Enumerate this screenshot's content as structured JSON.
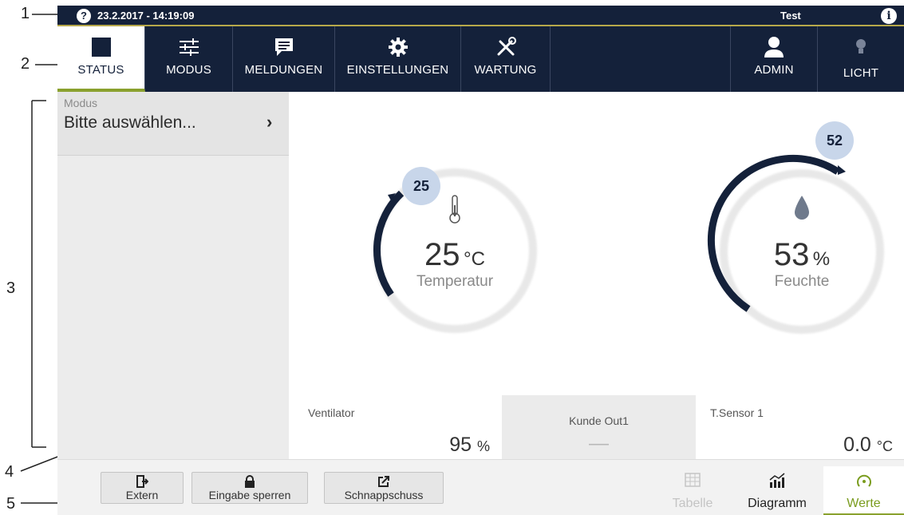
{
  "callouts": [
    "1",
    "2",
    "3",
    "4",
    "5"
  ],
  "statusbar": {
    "help_icon": "?",
    "datetime": "23.2.2017 - 14:19:09",
    "user": "Test",
    "info_icon": "i"
  },
  "nav": {
    "tabs": [
      {
        "label": "STATUS",
        "icon": "stop-square-icon",
        "active": true
      },
      {
        "label": "MODUS",
        "icon": "sliders-icon",
        "active": false
      },
      {
        "label": "MELDUNGEN",
        "icon": "message-icon",
        "active": false
      },
      {
        "label": "EINSTELLUNGEN",
        "icon": "gear-icon",
        "active": false
      },
      {
        "label": "WARTUNG",
        "icon": "tools-icon",
        "active": false
      }
    ],
    "right": [
      {
        "label": "ADMIN",
        "icon": "user-icon"
      },
      {
        "label": "LICHT",
        "icon": "lightbulb-icon"
      }
    ]
  },
  "sidebar": {
    "modus_label": "Modus",
    "modus_value": "Bitte auswählen...",
    "chevron": "›"
  },
  "gauges": [
    {
      "name": "temperature",
      "value": "25",
      "unit": "°C",
      "label": "Temperatur",
      "setpoint": "25",
      "icon": "thermometer-icon"
    },
    {
      "name": "humidity",
      "value": "53",
      "unit": "%",
      "label": "Feuchte",
      "setpoint": "52",
      "icon": "droplet-icon"
    }
  ],
  "tiles": [
    {
      "label": "Ventilator",
      "value": "95",
      "unit": "%"
    },
    {
      "label": "Kunde Out1",
      "value": "—",
      "unit": ""
    },
    {
      "label": "T.Sensor 1",
      "value": "0.0",
      "unit": "°C"
    }
  ],
  "bottom": {
    "buttons": [
      {
        "label": "Extern",
        "icon": "exit-icon"
      },
      {
        "label": "Eingabe sperren",
        "icon": "lock-icon"
      },
      {
        "label": "Schnappschuss",
        "icon": "snapshot-icon"
      }
    ],
    "views": [
      {
        "label": "Tabelle",
        "icon": "table-icon",
        "state": "disabled"
      },
      {
        "label": "Diagramm",
        "icon": "chart-icon",
        "state": "normal"
      },
      {
        "label": "Werte",
        "icon": "gauge-icon",
        "state": "active"
      }
    ]
  },
  "colors": {
    "navy": "#14213a",
    "accent_green": "#8aa12e",
    "bubble": "#c8d6ea",
    "ring": "#e6e6e6"
  }
}
